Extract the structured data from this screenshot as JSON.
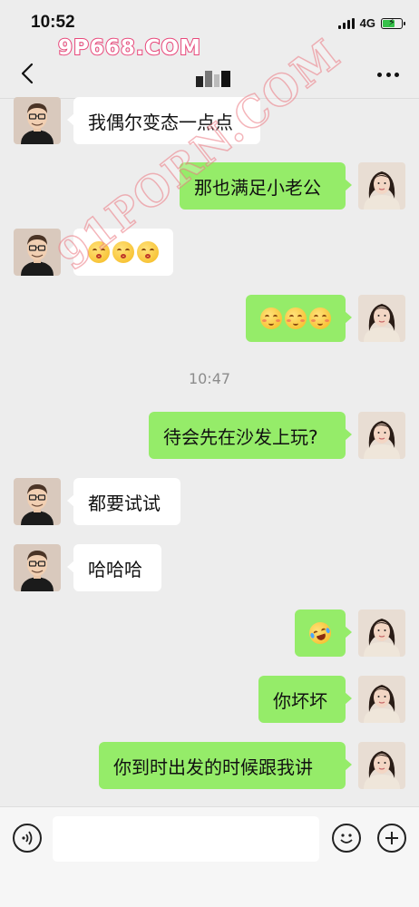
{
  "status_bar": {
    "time": "10:52",
    "network": "4G",
    "battery_level": 0.6
  },
  "watermarks": {
    "top": "9P668.COM",
    "diagonal": "91PORN.COM"
  },
  "header": {
    "title": "",
    "back_icon": "chevron-left-icon",
    "more_icon": "more-dots-icon"
  },
  "conversation": {
    "timestamp": "10:47",
    "messages": [
      {
        "side": "left",
        "text": "我偶尔变态一点点"
      },
      {
        "side": "right",
        "text": "那也满足小老公"
      },
      {
        "side": "left",
        "emoji": [
          "kiss-emoji",
          "kiss-emoji",
          "kiss-emoji"
        ]
      },
      {
        "side": "right",
        "emoji": [
          "shy-emoji",
          "shy-emoji",
          "shy-emoji"
        ]
      },
      {
        "side": "right",
        "text": "待会先在沙发上玩?"
      },
      {
        "side": "left",
        "text": "都要试试"
      },
      {
        "side": "left",
        "text": "哈哈哈"
      },
      {
        "side": "right",
        "emoji": [
          "rofl-emoji"
        ]
      },
      {
        "side": "right",
        "text": "你坏坏"
      },
      {
        "side": "right",
        "text": "你到时出发的时候跟我讲"
      }
    ]
  },
  "bottom_bar": {
    "input_value": "",
    "voice_icon": "voice-icon",
    "emoji_icon": "smile-icon",
    "plus_icon": "plus-icon"
  },
  "colors": {
    "self_bubble": "#95ec69",
    "other_bubble": "#ffffff",
    "background": "#ededed"
  }
}
